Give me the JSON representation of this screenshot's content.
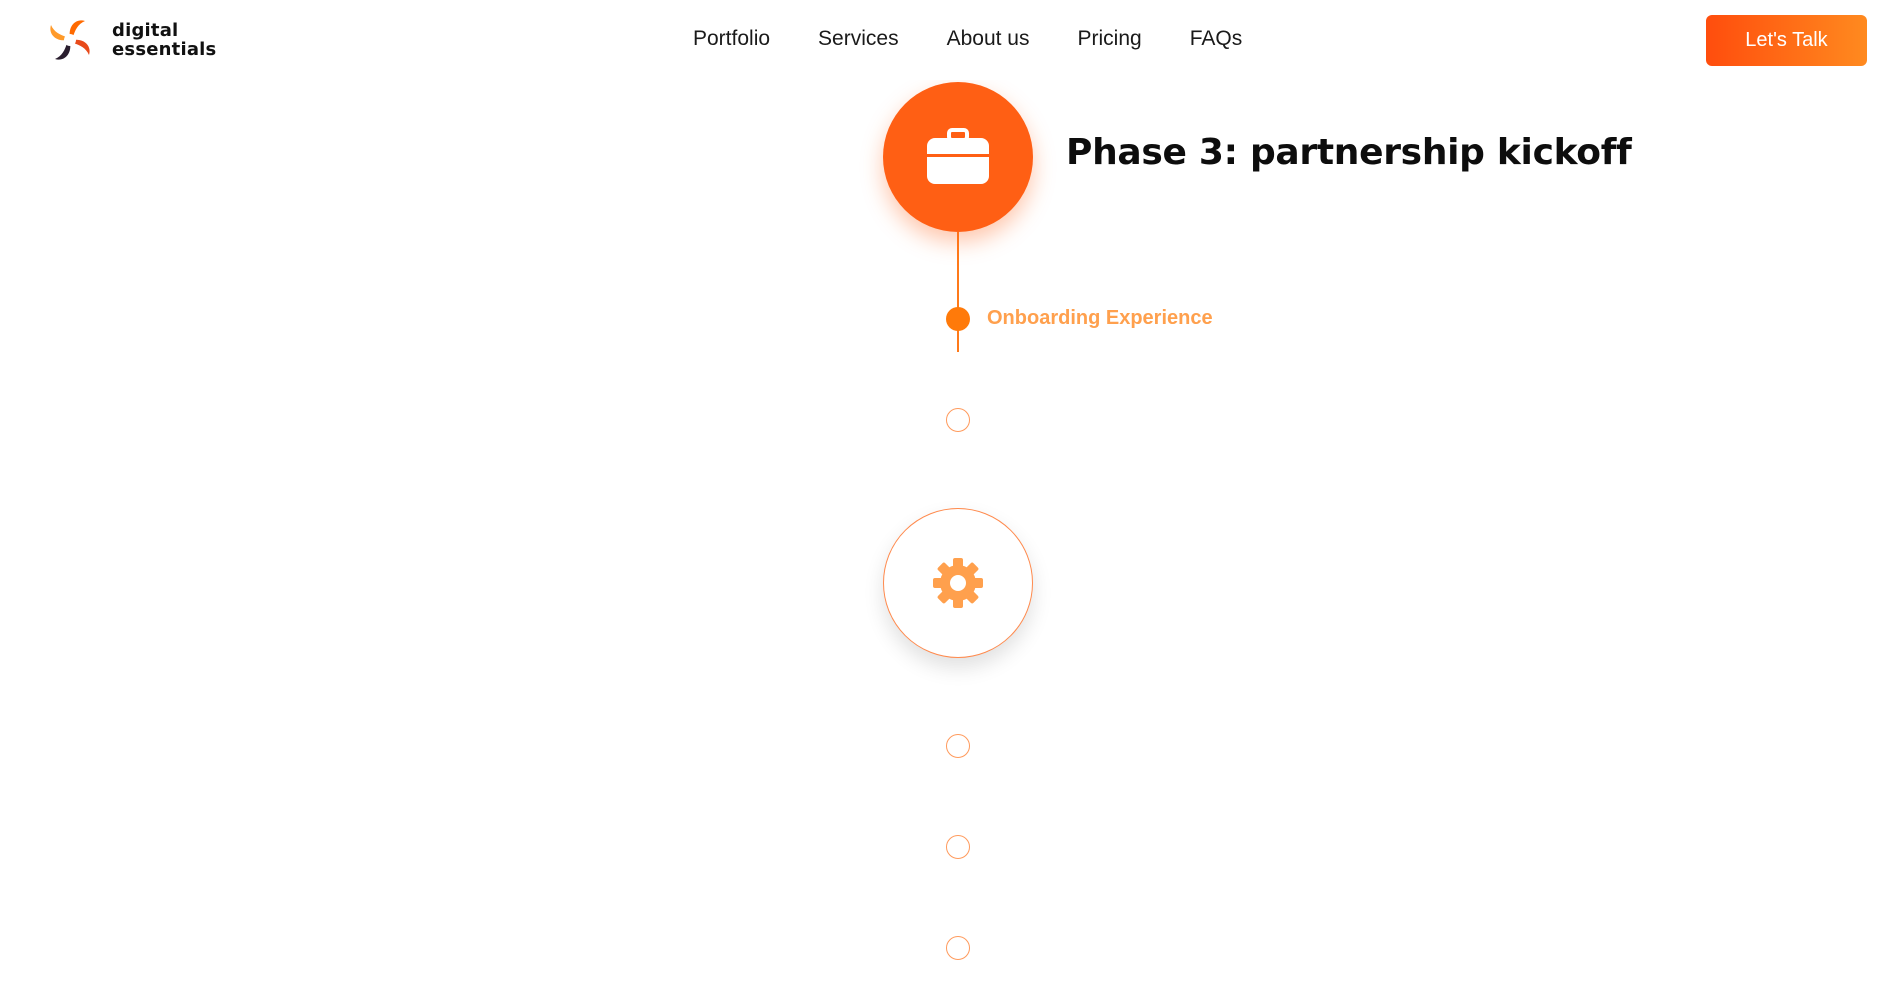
{
  "header": {
    "logo": {
      "line1": "digital",
      "line2": "essentials",
      "icon": "swirl-logo-icon"
    },
    "nav": [
      {
        "label": "Portfolio"
      },
      {
        "label": "Services"
      },
      {
        "label": "About us"
      },
      {
        "label": "Pricing"
      },
      {
        "label": "FAQs"
      }
    ],
    "cta_label": "Let's Talk"
  },
  "timeline": {
    "phase": {
      "title": "Phase 3: partnership kickoff",
      "icon": "briefcase-icon"
    },
    "active_step": {
      "label": "Onboarding Experience"
    },
    "next_phase_icon": "gear-icon"
  },
  "colors": {
    "accent": "#ff5f14",
    "accent_light": "#ffa04d",
    "cta_gradient_start": "#ff4d0d",
    "cta_gradient_end": "#ff8a1f"
  }
}
